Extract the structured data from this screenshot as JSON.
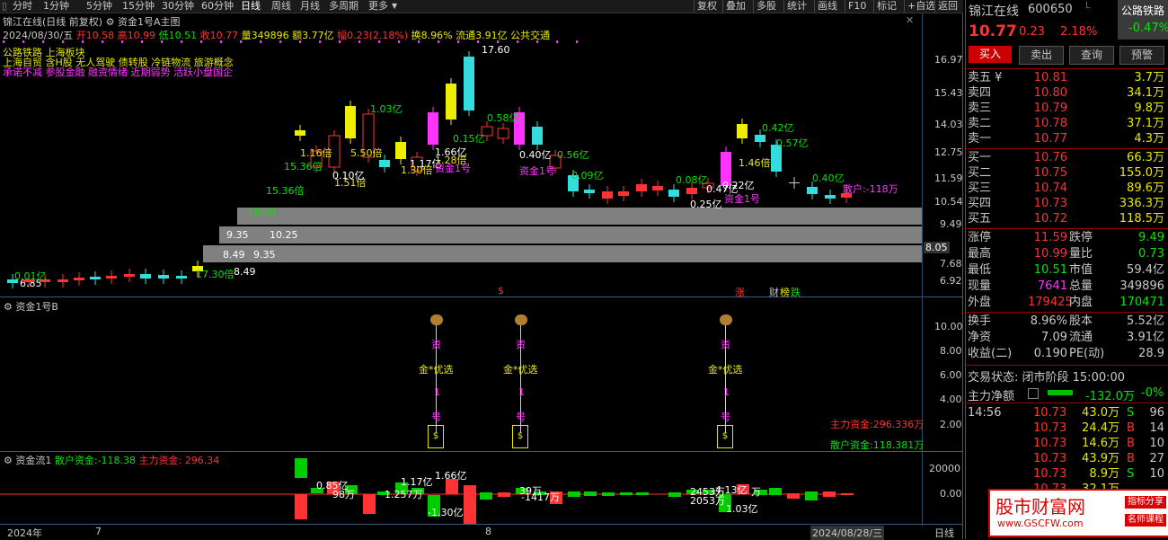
{
  "toolbar": {
    "tabs": [
      "分时",
      "1分钟",
      "5分钟",
      "15分钟",
      "30分钟",
      "60分钟",
      "日线",
      "周线",
      "月线",
      "多周期",
      "更多"
    ],
    "active_tab": "日线",
    "right_buttons": [
      "复权",
      "叠加",
      "多股",
      "统计",
      "画线",
      "F10",
      "标记",
      "+自选",
      "返回"
    ]
  },
  "main_chart": {
    "title": "锦江在线(日线 前复权)",
    "indicator": "资金1号A主图",
    "info": {
      "date": "2024/08/30/五",
      "open": "开10.58",
      "high": "高10.99",
      "low": "低10.51",
      "close": "收10.77",
      "volume": "量349896",
      "amount": "额3.77亿",
      "change": "幅0.23(2.18%)",
      "turnover": "换8.96%",
      "float": "流通3.91亿",
      "sector": "公共交通"
    },
    "concepts": [
      "公路铁路 上海板块",
      "上海自贸 含H股 无人驾驶 债转股 冷链物流 旅游概念",
      "承诺不减 参股金融 融资情绪 近期弱势 活跃小盘国企"
    ],
    "y_axis": [
      "16.97",
      "15.43",
      "14.03",
      "12.75",
      "11.59",
      "10.54",
      "9.49",
      "8.05",
      "7.68",
      "6.92"
    ],
    "current_price_tag": "8.05",
    "peak_label": "17.60",
    "box_labels": [
      "10.30",
      "9.35",
      "10.25",
      "8.49",
      "9.35",
      "8.49",
      "6.85"
    ],
    "annotations": [
      {
        "text": "0.01亿",
        "color": "#00e600"
      },
      {
        "text": "17.30倍",
        "color": "#00e600"
      },
      {
        "text": "15.36倍",
        "color": "#00e600"
      },
      {
        "text": "15.36倍",
        "color": "#00e600"
      },
      {
        "text": "1.16倍",
        "color": "#e8e800"
      },
      {
        "text": "1.51倍",
        "color": "#e8e800"
      },
      {
        "text": "0.10亿",
        "color": "#ffffff"
      },
      {
        "text": "5.50倍",
        "color": "#e8e800"
      },
      {
        "text": "1.03亿",
        "color": "#00e600"
      },
      {
        "text": "1.17亿",
        "color": "#ffffff"
      },
      {
        "text": "1.30倍",
        "color": "#e8e800"
      },
      {
        "text": "1.66亿",
        "color": "#ffffff"
      },
      {
        "text": "1.28倍",
        "color": "#e8e800"
      },
      {
        "text": "资金1号",
        "color": "#ff33ff"
      },
      {
        "text": "0.15亿",
        "color": "#00e600"
      },
      {
        "text": "0.58亿",
        "color": "#00e600"
      },
      {
        "text": "0.40亿",
        "color": "#ffffff"
      },
      {
        "text": "0.56亿",
        "color": "#00e600"
      },
      {
        "text": "资金1号",
        "color": "#ff33ff"
      },
      {
        "text": "0.09亿",
        "color": "#00e600"
      },
      {
        "text": "0.08亿",
        "color": "#00e600"
      },
      {
        "text": "0.47亿",
        "color": "#ffffff"
      },
      {
        "text": "0.22亿",
        "color": "#ffffff"
      },
      {
        "text": "资金1号",
        "color": "#ff33ff"
      },
      {
        "text": "0.25亿",
        "color": "#ffffff"
      },
      {
        "text": "0.42亿",
        "color": "#00e600"
      },
      {
        "text": "0.57亿",
        "color": "#00e600"
      },
      {
        "text": "1.46倍",
        "color": "#e8e800"
      },
      {
        "text": "0.40亿",
        "color": "#00e600"
      },
      {
        "text": "散户:-118万",
        "color": "#ff33ff"
      }
    ],
    "markers": [
      "$",
      "涨",
      "财",
      "榜",
      "跌"
    ]
  },
  "panel2": {
    "title": "资金1号B",
    "y_axis": [
      "10.00",
      "8.00",
      "6.00",
      "4.00",
      "2.00"
    ],
    "signal_text": [
      "资",
      "金*优选",
      "1",
      "号"
    ],
    "main_funds": "主力资金:296.336万",
    "retail_funds": "散户资金:118.381万"
  },
  "panel3": {
    "title": "资金流1",
    "retail_label": "散户资金:-118.38",
    "main_label": "主力资金: 296.34",
    "y_axis": [
      "20000",
      "0.00"
    ],
    "labels": [
      "0.85亿",
      "98万",
      "1.17亿",
      "1.66亿",
      "1.257万",
      "39万",
      "-1417万",
      "-1.30亿",
      "2453万",
      "2053万",
      "4.13亿",
      "1.03亿",
      "万"
    ]
  },
  "x_axis": {
    "labels": [
      "2024年",
      "7",
      "8"
    ],
    "date_box": "2024/08/28/三",
    "period": "日线"
  },
  "quote_panel": {
    "name": "锦江在线",
    "code": "600650",
    "tag": "公路铁路",
    "tag_change": "-0.47%",
    "price": "10.77",
    "change": "0.23",
    "change_pct": "2.18%",
    "buttons": [
      "买入",
      "卖出",
      "查询",
      "预警"
    ],
    "asks": [
      {
        "label": "卖五 ¥",
        "price": "10.81",
        "vol": "3.7万"
      },
      {
        "label": "卖四",
        "price": "10.80",
        "vol": "34.1万"
      },
      {
        "label": "卖三",
        "price": "10.79",
        "vol": "9.8万"
      },
      {
        "label": "卖二",
        "price": "10.78",
        "vol": "37.1万"
      },
      {
        "label": "卖一",
        "price": "10.77",
        "vol": "4.3万"
      }
    ],
    "bids": [
      {
        "label": "买一",
        "price": "10.76",
        "vol": "66.3万"
      },
      {
        "label": "买二",
        "price": "10.75",
        "vol": "155.0万"
      },
      {
        "label": "买三",
        "price": "10.74",
        "vol": "89.6万"
      },
      {
        "label": "买四",
        "price": "10.73",
        "vol": "336.3万"
      },
      {
        "label": "买五",
        "price": "10.72",
        "vol": "118.5万"
      }
    ],
    "stats": [
      {
        "l1": "涨停",
        "v1": "11.59",
        "c1": "#ff3232",
        "l2": "跌停",
        "v2": "9.49",
        "c2": "#00e600"
      },
      {
        "l1": "最高",
        "v1": "10.99",
        "c1": "#ff3232",
        "l2": "量比",
        "v2": "0.73",
        "c2": "#00e600"
      },
      {
        "l1": "最低",
        "v1": "10.51",
        "c1": "#00e600",
        "l2": "市值",
        "v2": "59.4亿",
        "c2": "#c8c8c8"
      },
      {
        "l1": "现量",
        "v1": "7641",
        "c1": "#ff33ff",
        "l2": "总量",
        "v2": "349896",
        "c2": "#c8c8c8"
      },
      {
        "l1": "外盘",
        "v1": "179425",
        "c1": "#ff3232",
        "l2": "内盘",
        "v2": "170471",
        "c2": "#00e600"
      }
    ],
    "stats2": [
      {
        "l1": "换手",
        "v1": "8.96%",
        "l2": "股本",
        "v2": "5.52亿"
      },
      {
        "l1": "净资",
        "v1": "7.09",
        "l2": "流通",
        "v2": "3.91亿"
      },
      {
        "l1": "收益(二)",
        "v1": "0.190",
        "l2": "PE(动)",
        "v2": "28.9"
      }
    ],
    "trade_status": "交易状态: 闭市阶段 15:00:00",
    "main_net": "主力净额",
    "main_net_value": "-132.0万",
    "main_net_pct": "-0%",
    "ticks": [
      {
        "time": "14:56",
        "price": "10.73",
        "vol": "43.0万",
        "side": "S",
        "n": "96"
      },
      {
        "time": "",
        "price": "10.73",
        "vol": "24.4万",
        "side": "B",
        "n": "14"
      },
      {
        "time": "",
        "price": "10.73",
        "vol": "14.6万",
        "side": "B",
        "n": "10"
      },
      {
        "time": "",
        "price": "10.73",
        "vol": "43.9万",
        "side": "B",
        "n": "27"
      },
      {
        "time": "",
        "price": "10.73",
        "vol": "8.9万",
        "side": "S",
        "n": "10"
      },
      {
        "time": "",
        "price": "10.73",
        "vol": "32.1万",
        "side": "",
        "n": ""
      }
    ],
    "watermark_main": "股市财富网",
    "watermark_url": "www.GSCFW.com",
    "watermark_tag1": "指标分享",
    "watermark_tag2": "名师课程"
  }
}
